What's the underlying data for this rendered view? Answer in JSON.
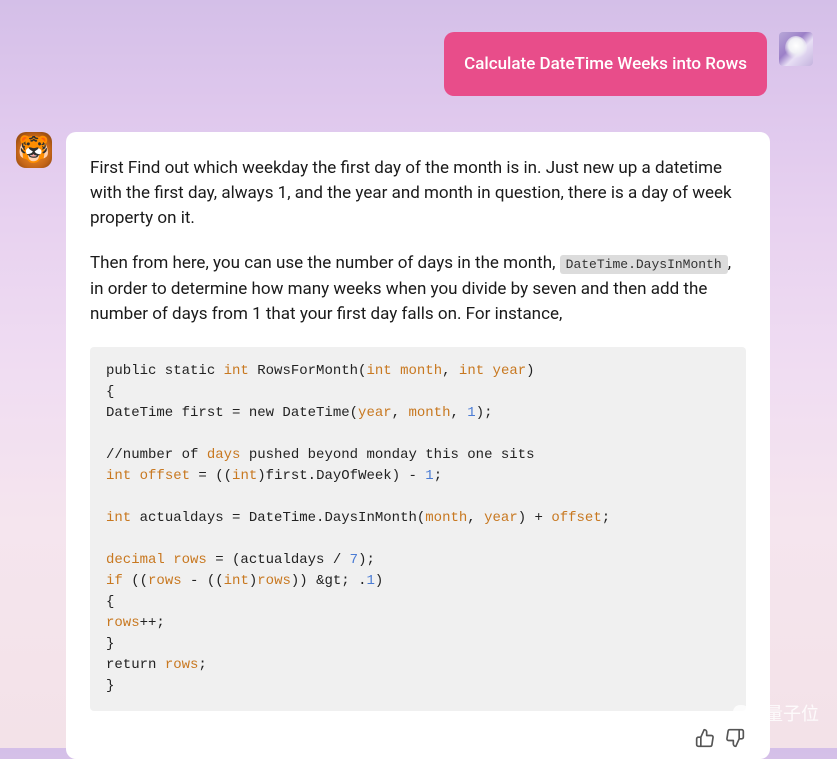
{
  "user": {
    "message": "Calculate DateTime Weeks into Rows"
  },
  "assistant": {
    "avatar_emoji": "🐯",
    "paragraph1": "First Find out which weekday the first day of the month is in. Just new up a datetime with the first day, always 1, and the year and month in question, there is a day of week property on it.",
    "paragraph2_before": "Then from here, you can use the number of days in the month, ",
    "paragraph2_code": "DateTime.DaysInMonth",
    "paragraph2_after": ", in order to determine how many weeks when you divide by seven and then add the number of days from 1 that your first day falls on. For instance,",
    "code": {
      "l1a": "public static ",
      "l1b": "int",
      "l1c": " RowsForMonth(",
      "l1d": "int",
      "l1e": " month",
      "l1f": ", ",
      "l1g": "int",
      "l1h": " year",
      "l1i": ")",
      "l2": "{",
      "l3a": "DateTime first = new DateTime(",
      "l3b": "year",
      "l3c": ", ",
      "l3d": "month",
      "l3e": ", ",
      "l3f": "1",
      "l3g": ");",
      "l4a": "//number of ",
      "l4b": "days",
      "l4c": " pushed beyond monday this one sits",
      "l5a": "int",
      "l5b": " offset",
      "l5c": " = ((",
      "l5d": "int",
      "l5e": ")first.DayOfWeek) - ",
      "l5f": "1",
      "l5g": ";",
      "l6a": "int",
      "l6b": " actualdays = DateTime.DaysInMonth(",
      "l6c": "month",
      "l6d": ", ",
      "l6e": "year",
      "l6f": ") + ",
      "l6g": "offset",
      "l6h": ";",
      "l7a": "decimal",
      "l7b": " rows",
      "l7c": " = (actualdays / ",
      "l7d": "7",
      "l7e": ");",
      "l8a": "if",
      "l8b": " ((",
      "l8c": "rows",
      "l8d": " - ((",
      "l8e": "int",
      "l8f": ")",
      "l8g": "rows",
      "l8h": ")) &gt; .",
      "l8i": "1",
      "l8j": ")",
      "l9": "{",
      "l10a": "rows",
      "l10b": "++;",
      "l11": "}",
      "l12a": "return ",
      "l12b": "rows",
      "l12c": ";",
      "l13": "}"
    }
  },
  "watermark": {
    "text": "量子位"
  }
}
